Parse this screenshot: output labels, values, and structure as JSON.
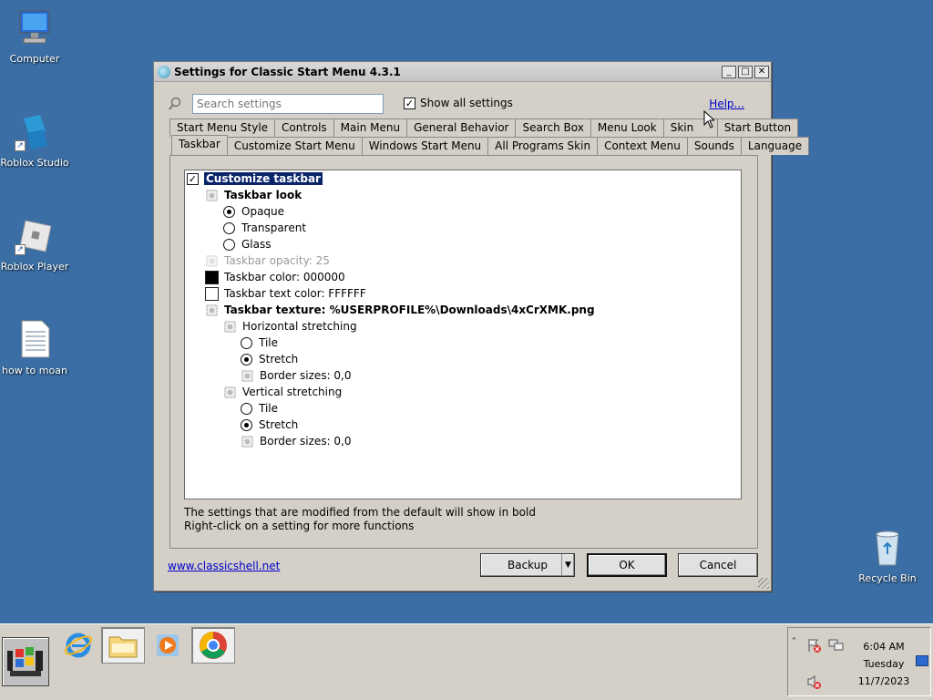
{
  "desktop": {
    "icons": [
      {
        "label": "Computer"
      },
      {
        "label": "Roblox Studio"
      },
      {
        "label": "Roblox Player"
      },
      {
        "label": "how to moan"
      },
      {
        "label": "Recycle Bin"
      }
    ]
  },
  "window": {
    "title": "Settings for Classic Start Menu 4.3.1",
    "search_placeholder": "Search settings",
    "show_all_label": "Show all settings",
    "show_all_checked": true,
    "help_label": "Help...",
    "tabs_row1": [
      "Start Menu Style",
      "Controls",
      "Main Menu",
      "General Behavior",
      "Search Box",
      "Menu Look",
      "Skin",
      "Start Button"
    ],
    "tabs_row2": [
      "Taskbar",
      "Customize Start Menu",
      "Windows Start Menu",
      "All Programs Skin",
      "Context Menu",
      "Sounds",
      "Language"
    ],
    "active_tab": "Taskbar",
    "tree": {
      "customize_taskbar": "Customize taskbar",
      "taskbar_look": "Taskbar look",
      "opaque": "Opaque",
      "transparent": "Transparent",
      "glass": "Glass",
      "opacity": "Taskbar opacity: 25",
      "color": "Taskbar color: 000000",
      "text_color": "Taskbar text color: FFFFFF",
      "texture": "Taskbar texture: %USERPROFILE%\\Downloads\\4xCrXMK.png",
      "horizontal": "Horizontal stretching",
      "h_tile": "Tile",
      "h_stretch": "Stretch",
      "h_border": "Border sizes: 0,0",
      "vertical": "Vertical stretching",
      "v_tile": "Tile",
      "v_stretch": "Stretch",
      "v_border": "Border sizes: 0,0"
    },
    "hint1": "The settings that are modified from the default will show in bold",
    "hint2": "Right-click on a setting for more functions",
    "site_link": "www.classicshell.net",
    "backup_label": "Backup",
    "ok_label": "OK",
    "cancel_label": "Cancel"
  },
  "taskbar": {
    "clock_time": "6:04 AM",
    "clock_day": "Tuesday",
    "clock_date": "11/7/2023"
  },
  "colors": {
    "desktop": "#3a6ea5",
    "selection": "#0a246a",
    "link": "#0000cc"
  }
}
